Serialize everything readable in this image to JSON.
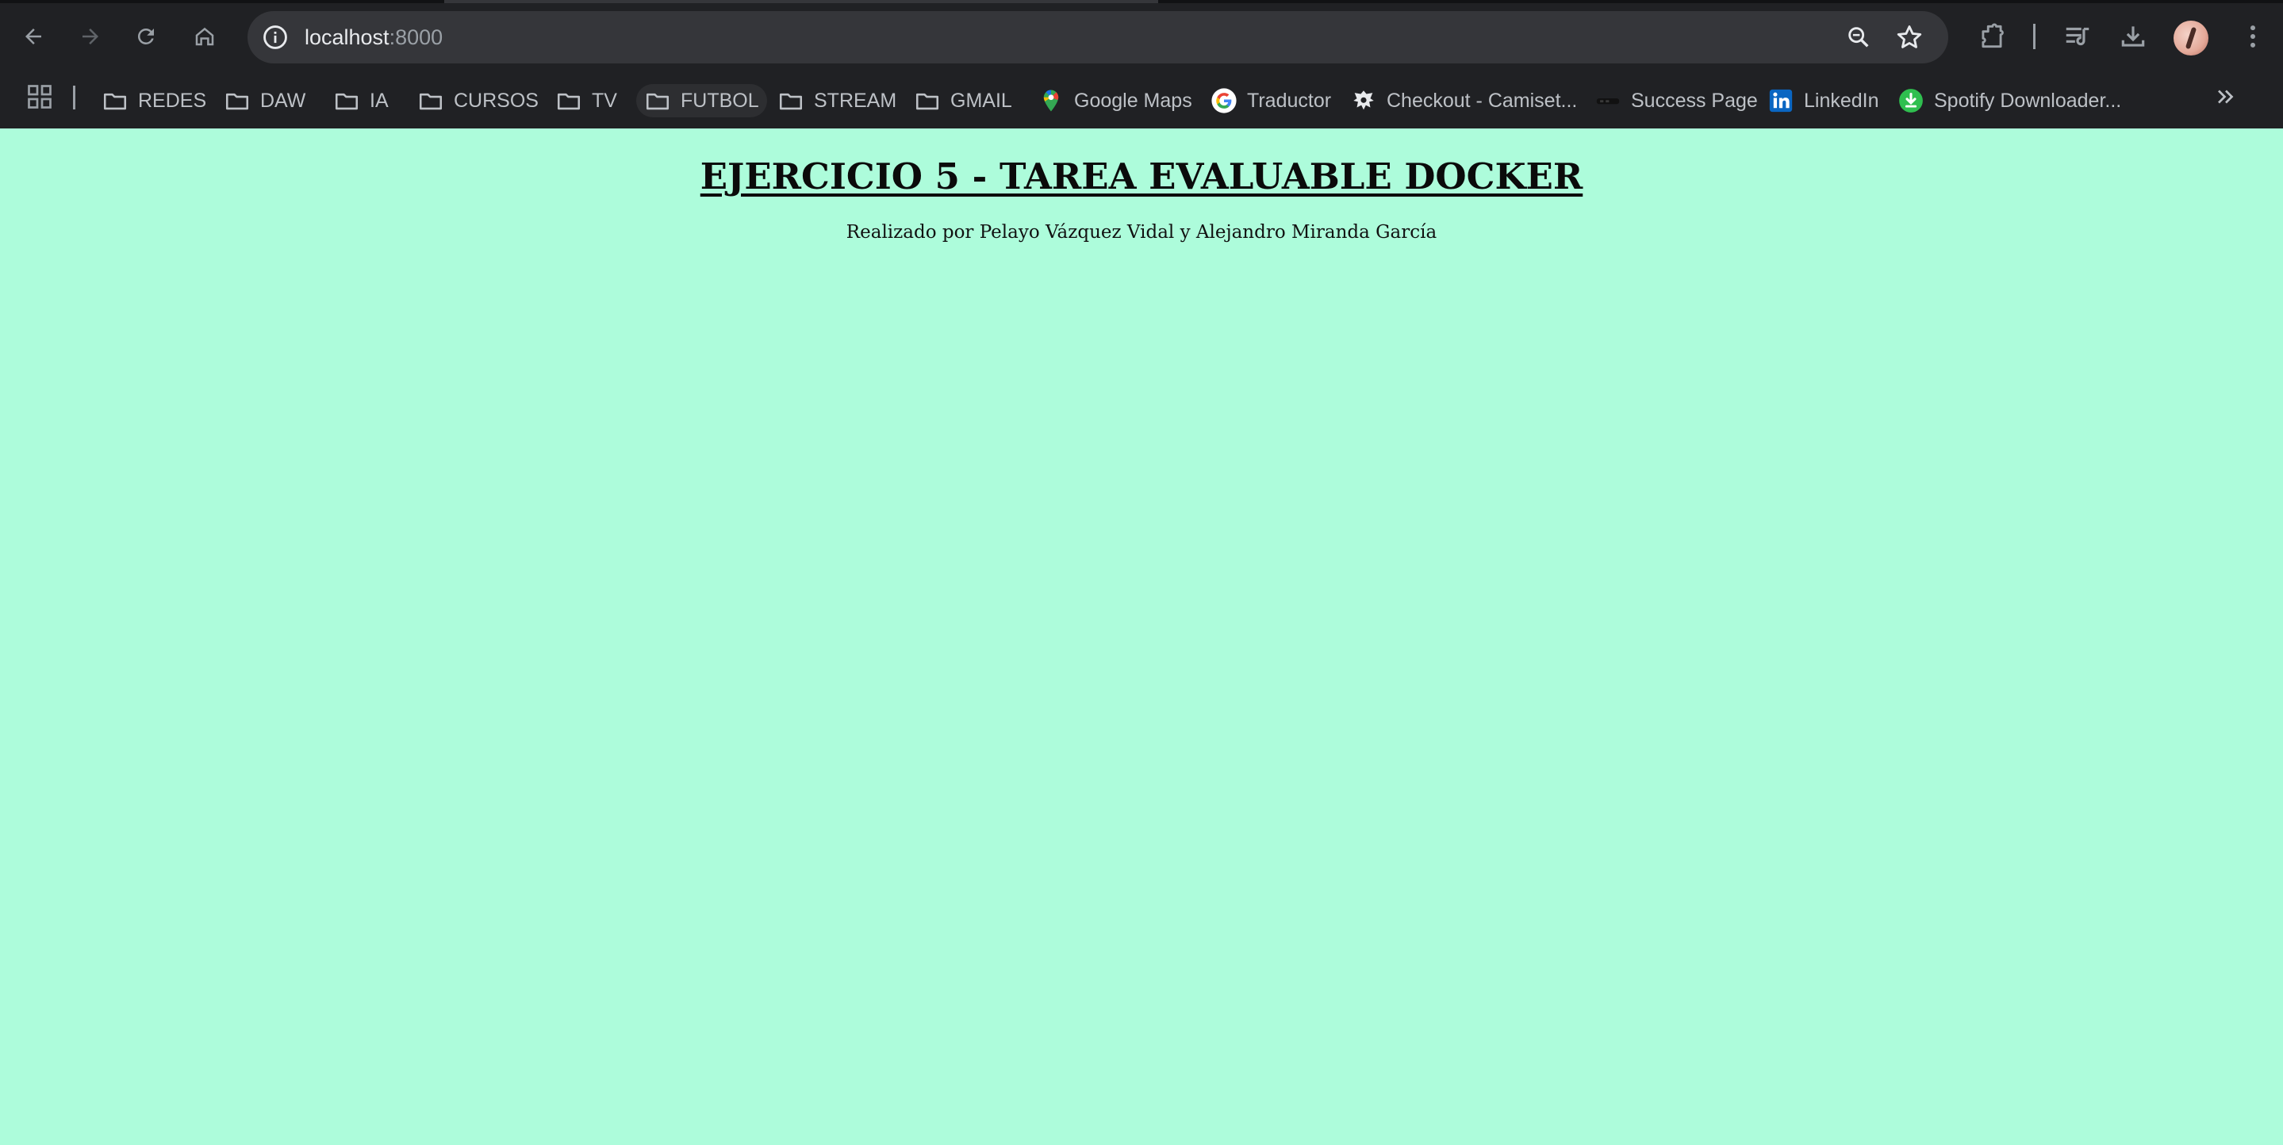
{
  "browser": {
    "address_bar": {
      "host": "localhost",
      "port": ":8000"
    },
    "bookmarks": [
      {
        "label": "REDES",
        "icon": "folder-icon"
      },
      {
        "label": "DAW",
        "icon": "folder-icon"
      },
      {
        "label": "IA",
        "icon": "folder-icon"
      },
      {
        "label": "CURSOS",
        "icon": "folder-icon"
      },
      {
        "label": "TV",
        "icon": "folder-icon"
      },
      {
        "label": "FUTBOL",
        "icon": "folder-icon"
      },
      {
        "label": "STREAM",
        "icon": "folder-icon"
      },
      {
        "label": "GMAIL",
        "icon": "folder-icon"
      },
      {
        "label": "Google Maps",
        "icon": "google-maps-icon"
      },
      {
        "label": "Traductor",
        "icon": "google-icon"
      },
      {
        "label": "Checkout - Camiset...",
        "icon": "crest-icon"
      },
      {
        "label": "Success Page",
        "icon": "site-logo-icon"
      },
      {
        "label": "LinkedIn",
        "icon": "linkedin-icon"
      },
      {
        "label": "Spotify Downloader...",
        "icon": "download-circle-icon"
      }
    ]
  },
  "page": {
    "title": "EJERCICIO 5 - TAREA EVALUABLE DOCKER",
    "subtitle": "Realizado por Pelayo Vázquez Vidal y Alejandro Miranda García",
    "background_color": "#adfcdb"
  }
}
